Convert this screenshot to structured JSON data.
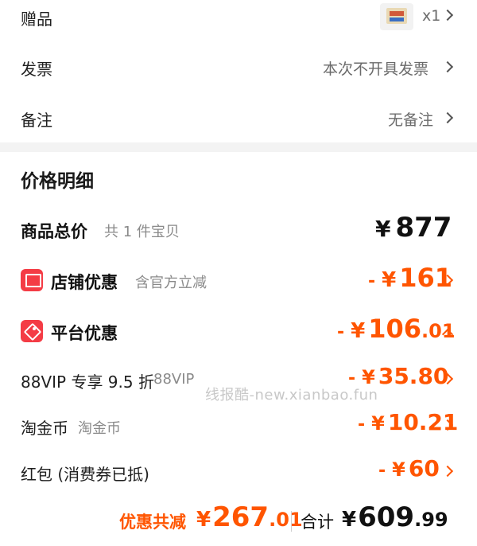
{
  "order": {
    "gift": {
      "label": "赠品",
      "quantity": "x1",
      "thumbnail_icon": "gift-product-thumbnail"
    },
    "invoice": {
      "label": "发票",
      "value": "本次不开具发票"
    },
    "remark": {
      "label": "备注",
      "value": "无备注"
    }
  },
  "price_detail": {
    "title": "价格明细",
    "goods_total": {
      "label": "商品总价",
      "sub": "共 1 件宝贝",
      "yen": "¥",
      "amount": "877"
    },
    "shop_discount": {
      "icon": "shop-icon",
      "label": "店铺优惠",
      "sub": "含官方立减",
      "minus": "-",
      "yen": "¥",
      "amount": "161"
    },
    "platform_discount": {
      "icon": "tag-icon",
      "label": "平台优惠",
      "minus": "-",
      "yen": "¥",
      "amount_int": "106",
      "amount_dec": ".01",
      "expanded": true,
      "items": [
        {
          "label": "88VIP 专享 9.5 折",
          "sub": "88VIP",
          "minus": "-",
          "yen": "¥",
          "amount": "35.80"
        },
        {
          "label": "淘金币",
          "sub": "淘金币",
          "minus": "-",
          "yen": "¥",
          "amount": "10.21"
        },
        {
          "label": "红包 (消费券已抵)",
          "sub": "",
          "minus": "-",
          "yen": "¥",
          "amount": "60"
        }
      ]
    }
  },
  "watermark": "线报酷-new.xianbao.fun",
  "footer": {
    "save_label": "优惠共减",
    "save_yen": "¥",
    "save_int": "267",
    "save_dec": ".01",
    "total_label": "合计",
    "total_yen": "¥",
    "total_int": "609",
    "total_dec": ".99"
  },
  "colors": {
    "accent": "#ff5500",
    "badge": "#f43c45",
    "divider": "#f3f3f3"
  }
}
